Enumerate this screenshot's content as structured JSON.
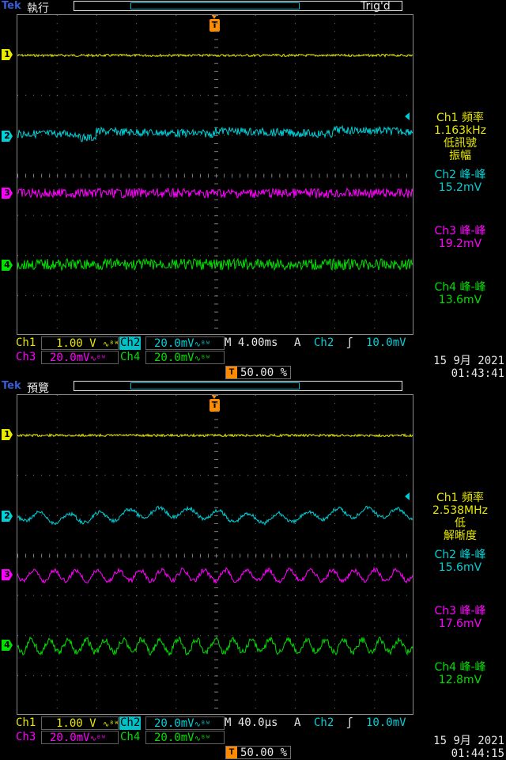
{
  "screens": [
    {
      "brand": "Tek",
      "mode": "執行",
      "trig_state": "Trig'd",
      "trigger_marker": "T",
      "channel_markers": [
        "1",
        "2",
        "3",
        "4"
      ],
      "measurements": [
        {
          "label": "Ch1 頻率",
          "value": "1.163kHz",
          "note1": "低訊號",
          "note2": "振幅"
        },
        {
          "label": "Ch2 峰-峰",
          "value": "15.2mV"
        },
        {
          "label": "Ch3 峰-峰",
          "value": "19.2mV"
        },
        {
          "label": "Ch4 峰-峰",
          "value": "13.6mV"
        }
      ],
      "status": {
        "ch1_label": "Ch1",
        "ch1_scale": "1.00 V",
        "ch2_label": "Ch2",
        "ch2_scale": "20.0mV",
        "ch3_label": "Ch3",
        "ch3_scale": "20.0mV",
        "ch4_label": "Ch4",
        "ch4_scale": "20.0mV",
        "bw_mark": "∿ᴮᵂ",
        "timebase": "M 4.00ms",
        "trig_mode": "A",
        "trig_source": "Ch2",
        "trig_slope": "ʃ",
        "trig_level": "10.0mV",
        "trig_position_marker": "T",
        "trig_position": "50.00 %",
        "date": "15 9月  2021",
        "time": "01:43:41"
      }
    },
    {
      "brand": "Tek",
      "mode": "預覽",
      "trig_state": "",
      "trigger_marker": "T",
      "channel_markers": [
        "1",
        "2",
        "3",
        "4"
      ],
      "measurements": [
        {
          "label": "Ch1 頻率",
          "value": "2.538MHz",
          "note1": "低",
          "note2": "解晰度"
        },
        {
          "label": "Ch2 峰-峰",
          "value": "15.6mV"
        },
        {
          "label": "Ch3 峰-峰",
          "value": "17.6mV"
        },
        {
          "label": "Ch4 峰-峰",
          "value": "12.8mV"
        }
      ],
      "status": {
        "ch1_label": "Ch1",
        "ch1_scale": "1.00 V",
        "ch2_label": "Ch2",
        "ch2_scale": "20.0mV",
        "ch3_label": "Ch3",
        "ch3_scale": "20.0mV",
        "ch4_label": "Ch4",
        "ch4_scale": "20.0mV",
        "bw_mark": "∿ᴮᵂ",
        "timebase": "M 40.0µs",
        "trig_mode": "A",
        "trig_source": "Ch2",
        "trig_slope": "ʃ",
        "trig_level": "10.0mV",
        "trig_position_marker": "T",
        "trig_position": "50.00 %",
        "date": "15 9月  2021",
        "time": "01:44:15"
      }
    }
  ],
  "colors": {
    "ch1": "#e8e800",
    "ch2": "#00d0d8",
    "ch3": "#ff00ff",
    "ch4": "#00e000",
    "trigger": "#ff8c00",
    "text": "#e8e8e8",
    "grid": "#7a7a7a"
  }
}
